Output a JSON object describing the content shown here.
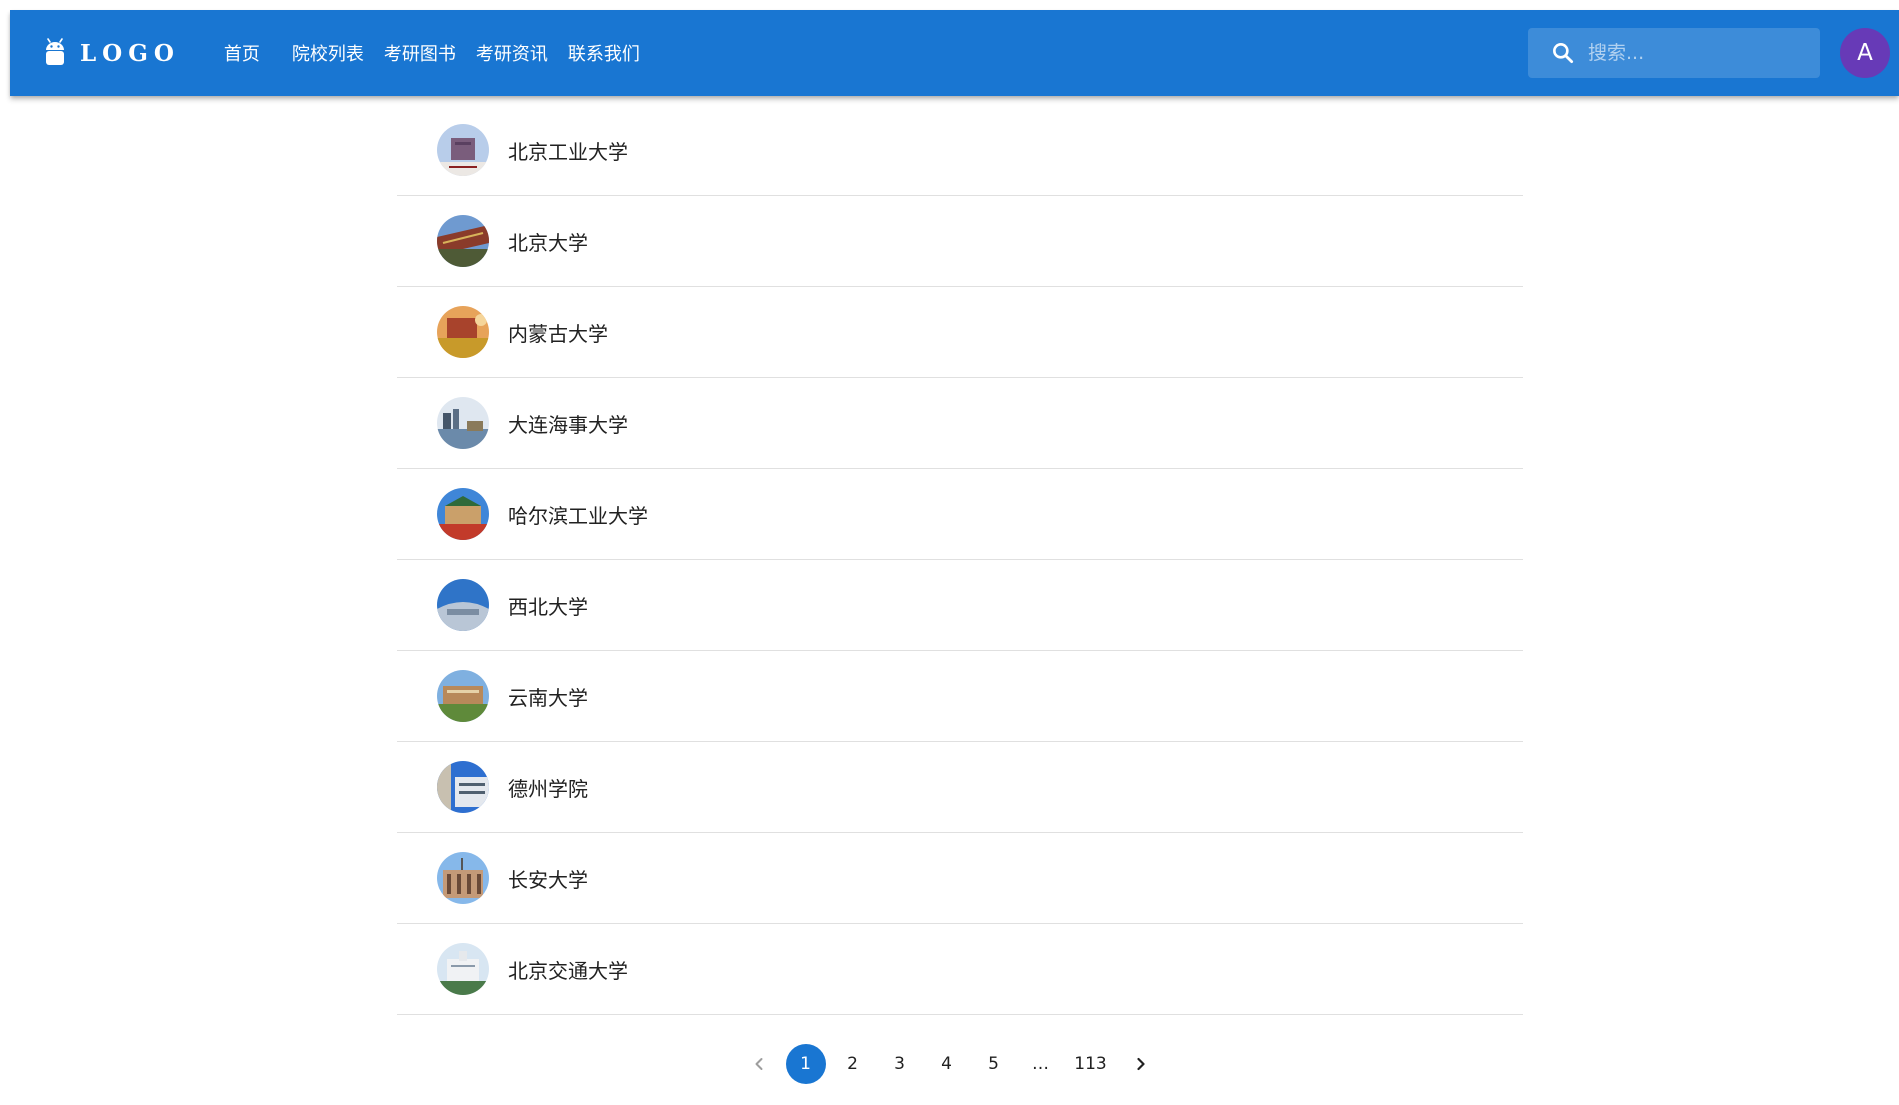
{
  "header": {
    "logo_text": "LOGO",
    "nav": [
      {
        "label": "首页"
      },
      {
        "label": "院校列表"
      },
      {
        "label": "考研图书"
      },
      {
        "label": "考研资讯"
      },
      {
        "label": "联系我们"
      }
    ],
    "search_placeholder": "搜索...",
    "avatar_letter": "A"
  },
  "colors": {
    "appbar": "#1976d2",
    "avatar": "#673ab7",
    "active_page": "#1976d2"
  },
  "schools": [
    {
      "name": "北京工业大学"
    },
    {
      "name": "北京大学"
    },
    {
      "name": "内蒙古大学"
    },
    {
      "name": "大连海事大学"
    },
    {
      "name": "哈尔滨工业大学"
    },
    {
      "name": "西北大学"
    },
    {
      "name": "云南大学"
    },
    {
      "name": "德州学院"
    },
    {
      "name": "长安大学"
    },
    {
      "name": "北京交通大学"
    }
  ],
  "pagination": {
    "pages": [
      "1",
      "2",
      "3",
      "4",
      "5",
      "…",
      "113"
    ],
    "current": "1"
  }
}
